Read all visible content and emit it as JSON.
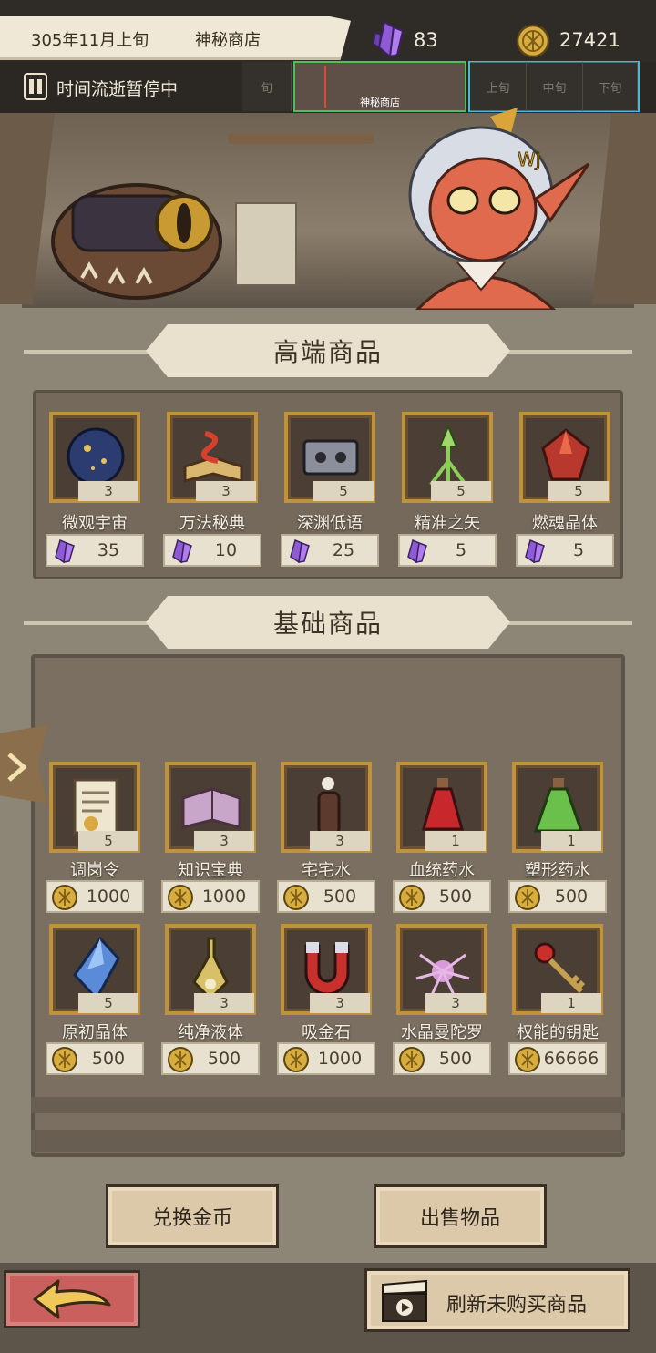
{
  "header": {
    "date": "305年11月上旬",
    "shop_name": "神秘商店",
    "gems": "83",
    "coins": "27421",
    "gem_icon": "purple-crystal-icon",
    "coin_icon": "gold-coin-icon"
  },
  "timeline": {
    "status": "时间流逝暂停中",
    "past_period": "旬",
    "current_label": "神秘商店",
    "future_periods": [
      "上旬",
      "中旬",
      "下旬"
    ],
    "current_color": "#4cc05a",
    "future_color": "#4cb8d8"
  },
  "premium": {
    "title": "高端商品",
    "items": [
      {
        "name": "微观宇宙",
        "qty": "3",
        "price": "35",
        "icon": "universe-orb-icon"
      },
      {
        "name": "万法秘典",
        "qty": "3",
        "price": "10",
        "icon": "spellbook-icon"
      },
      {
        "name": "深渊低语",
        "qty": "5",
        "price": "25",
        "icon": "cassette-tape-icon"
      },
      {
        "name": "精准之矢",
        "qty": "5",
        "price": "5",
        "icon": "arrow-rune-icon"
      },
      {
        "name": "燃魂晶体",
        "qty": "5",
        "price": "5",
        "icon": "burning-crystal-icon"
      }
    ]
  },
  "basic": {
    "title": "基础商品",
    "items": [
      {
        "name": "调岗令",
        "qty": "5",
        "price": "1000",
        "icon": "transfer-order-icon"
      },
      {
        "name": "知识宝典",
        "qty": "3",
        "price": "1000",
        "icon": "knowledge-book-icon"
      },
      {
        "name": "宅宅水",
        "qty": "3",
        "price": "500",
        "icon": "soda-bottle-icon"
      },
      {
        "name": "血统药水",
        "qty": "1",
        "price": "500",
        "icon": "red-potion-icon"
      },
      {
        "name": "塑形药水",
        "qty": "1",
        "price": "500",
        "icon": "green-potion-icon"
      },
      {
        "name": "原初晶体",
        "qty": "5",
        "price": "500",
        "icon": "blue-crystal-icon"
      },
      {
        "name": "纯净液体",
        "qty": "3",
        "price": "500",
        "icon": "pure-liquid-icon"
      },
      {
        "name": "吸金石",
        "qty": "3",
        "price": "1000",
        "icon": "magnet-icon"
      },
      {
        "name": "水晶曼陀罗",
        "qty": "3",
        "price": "500",
        "icon": "crystal-flower-icon"
      },
      {
        "name": "权能的钥匙",
        "qty": "1",
        "price": "66666",
        "icon": "ruby-key-icon"
      }
    ]
  },
  "actions": {
    "exchange": "兑换金币",
    "sell": "出售物品",
    "refresh": "刷新未购买商品"
  }
}
